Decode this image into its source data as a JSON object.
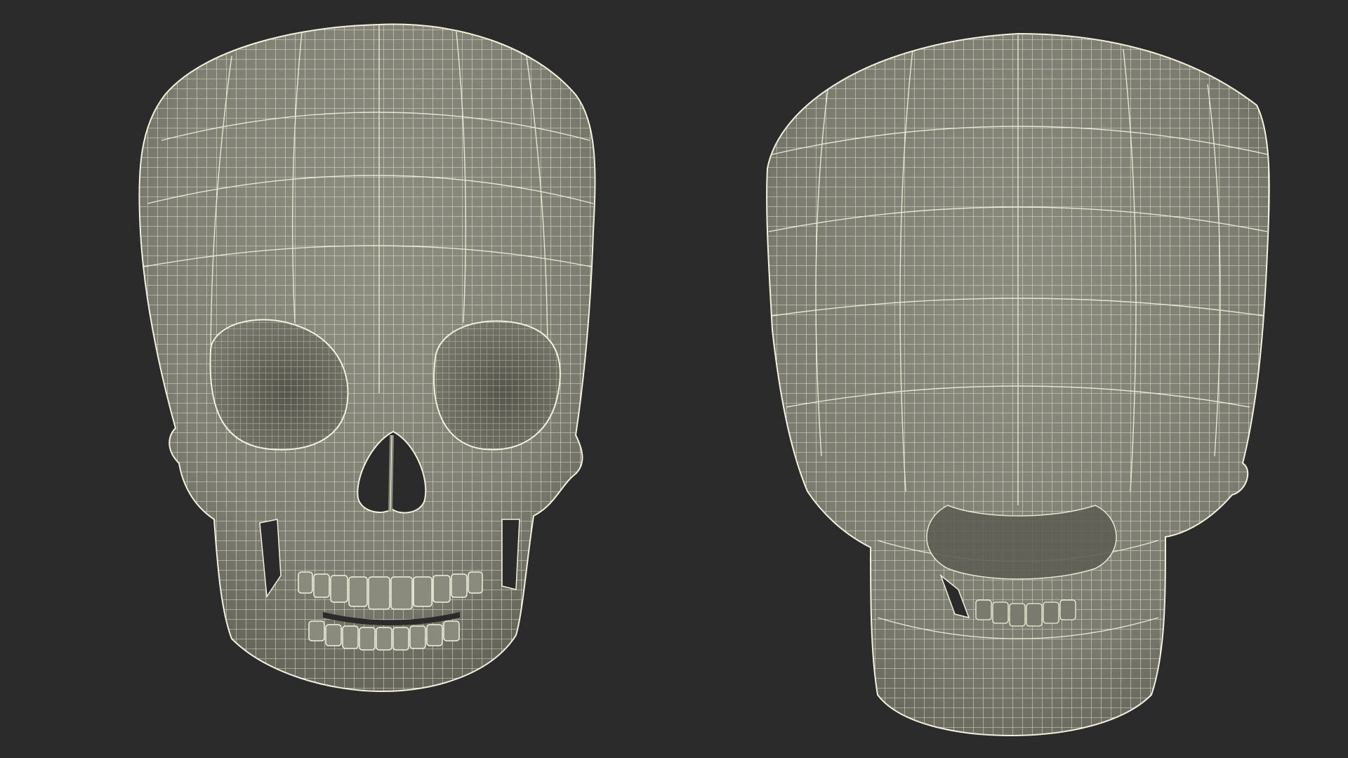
{
  "colors": {
    "background": "#2b2b2b",
    "bone_fill": "#8a8a7d",
    "bone_fill_dark": "#6e6e62",
    "wireframe": "#f3f1de",
    "cavity": "#4a4a42"
  },
  "views": [
    {
      "name": "skull-front-view"
    },
    {
      "name": "skull-back-view"
    }
  ]
}
